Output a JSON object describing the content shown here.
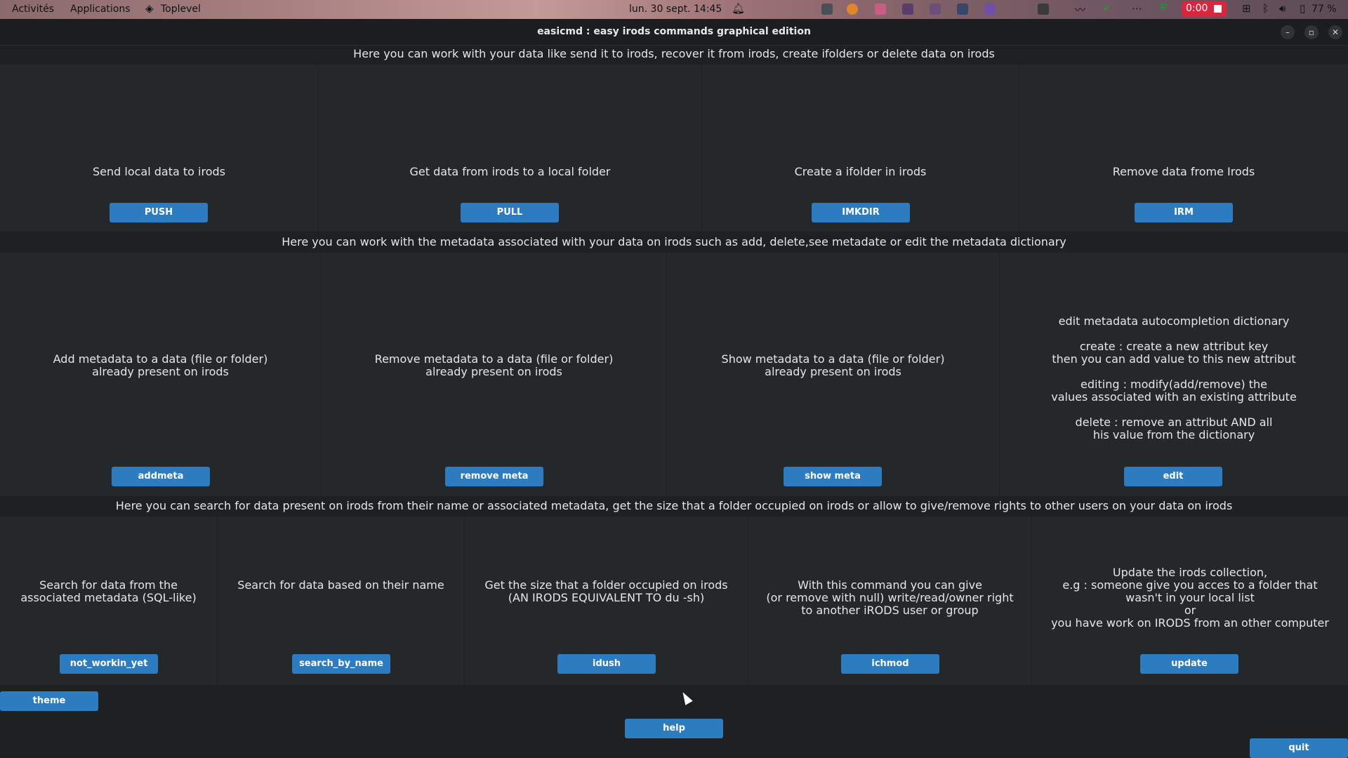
{
  "topbar": {
    "activities": "Activités",
    "applications": "Applications",
    "toplevel": "Toplevel",
    "clock": "lun. 30 sept. 14:45",
    "recording_time": "0:00",
    "battery": "77 %"
  },
  "window": {
    "title": "easicmd : easy irods commands graphical edition"
  },
  "section1": {
    "header": "Here you can work with your data like send it to irods, recover it from irods, create ifolders or delete data on irods",
    "cells": [
      {
        "desc": "Send local data to irods",
        "button": "PUSH"
      },
      {
        "desc": "Get data from irods to a local folder",
        "button": "PULL"
      },
      {
        "desc": "Create a ifolder in irods",
        "button": "IMKDIR"
      },
      {
        "desc": "Remove data frome Irods",
        "button": "IRM"
      }
    ]
  },
  "section2": {
    "header": "Here you can work with the metadata associated with your data on irods such as add, delete,see metadate or edit the metadata dictionary",
    "cells": [
      {
        "desc": "Add metadata to a data (file or folder)\nalready present on irods",
        "button": "addmeta"
      },
      {
        "desc": "Remove metadata to a data (file or folder)\nalready present on irods",
        "button": "remove meta"
      },
      {
        "desc": "Show metadata to a data (file or folder)\nalready present on irods",
        "button": "show meta"
      },
      {
        "desc": "edit metadata autocompletion dictionary\n\ncreate : create a new attribut key\nthen you can add value to this new attribut\n\nediting : modify(add/remove) the\nvalues associated with an existing attribute\n\ndelete : remove an attribut AND all\nhis value from the dictionary",
        "button": "edit"
      }
    ]
  },
  "section3": {
    "header": "Here you can search for data present on irods from their name or associated metadata, get the size that a folder occupied on irods or allow to give/remove rights to other users on your data on irods",
    "cells": [
      {
        "desc": "Search for data from the\nassociated metadata (SQL-like)",
        "button": "not_workin_yet"
      },
      {
        "desc": "Search for data based on their name",
        "button": "search_by_name"
      },
      {
        "desc": "Get the size that a folder occupied on irods\n(AN IRODS EQUIVALENT TO du -sh)",
        "button": "idush"
      },
      {
        "desc": "With this command you can give\n(or remove with null) write/read/owner right\nto another iRODS user or group",
        "button": "ichmod"
      },
      {
        "desc": "Update the irods collection,\ne.g : someone give you acces to a folder that\nwasn't in your local list\nor\nyou have work on IRODS from an other computer",
        "button": "update"
      }
    ]
  },
  "footer": {
    "theme": "theme",
    "help": "help",
    "quit": "quit"
  }
}
